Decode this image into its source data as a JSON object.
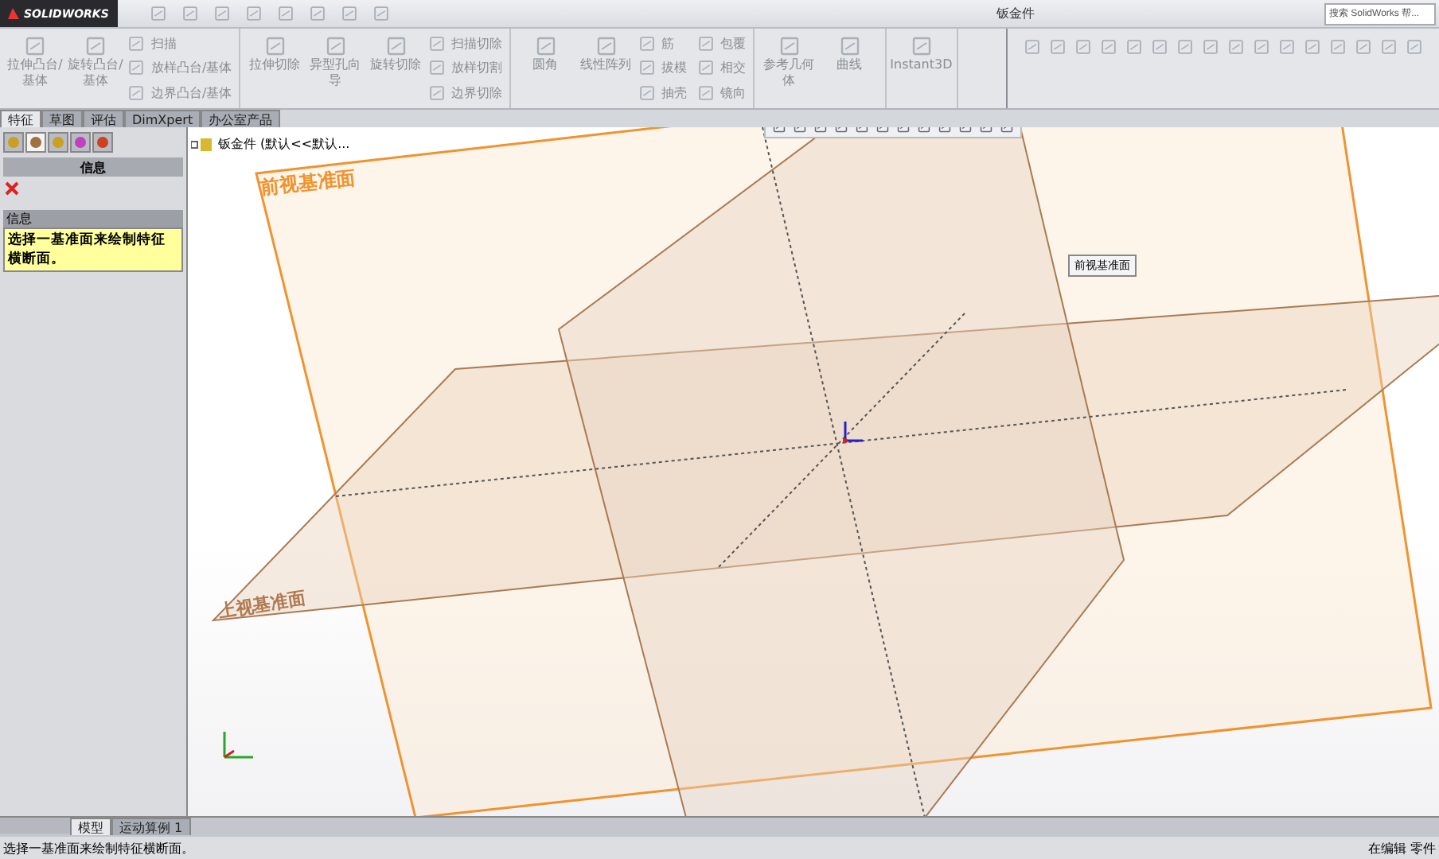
{
  "title_bar": {
    "logo": "SOLIDWORKS",
    "title": "钣金件",
    "search": {
      "placeholder": "搜索 SolidWorks 帮..."
    }
  },
  "ribbon": {
    "groups": [
      {
        "big": [
          "拉伸凸台/基体",
          "旋转凸台/基体"
        ],
        "small": [
          "扫描",
          "放样凸台/基体",
          "边界凸台/基体"
        ]
      },
      {
        "big": [
          "拉伸切除",
          "异型孔向导",
          "旋转切除"
        ],
        "small": [
          "扫描切除",
          "放样切割",
          "边界切除"
        ]
      },
      {
        "big": [
          "圆角",
          "线性阵列"
        ],
        "small": [
          "筋",
          "拔模",
          "抽壳",
          "包覆",
          "相交",
          "镜向"
        ]
      },
      {
        "big": [
          "参考几何体",
          "曲线"
        ]
      },
      {
        "big": [
          "Instant3D"
        ]
      }
    ]
  },
  "command_tabs": [
    {
      "label": "特征",
      "selected": true
    },
    {
      "label": "草图",
      "selected": false
    },
    {
      "label": "评估",
      "selected": false
    },
    {
      "label": "DimXpert",
      "selected": false
    },
    {
      "label": "办公室产品",
      "selected": false
    }
  ],
  "panel": {
    "icon_tabs": [
      {
        "selected": false
      },
      {
        "selected": true
      },
      {
        "selected": false
      },
      {
        "selected": false
      },
      {
        "selected": false
      }
    ],
    "header": "信息",
    "message_title": "信息",
    "message": "选择一基准面来绘制特征横断面。"
  },
  "viewport": {
    "tree_root": "钣金件 (默认<<默认...",
    "front_plane_label": "前视基准面",
    "top_plane_label": "上视基准面",
    "tooltip": "前视基准面"
  },
  "bottom_tabs": [
    {
      "label": "模型",
      "selected": true
    },
    {
      "label": "运动算例 1",
      "selected": false
    }
  ],
  "status_bar": {
    "message": "选择一基准面来绘制特征横断面。",
    "right": "在编辑 零件"
  }
}
